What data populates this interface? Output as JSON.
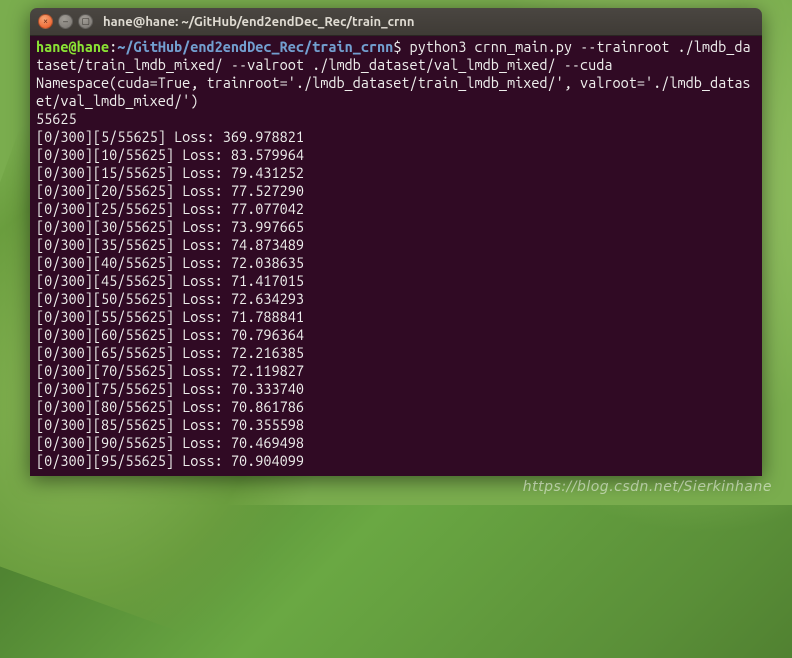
{
  "window": {
    "title": "hane@hane: ~/GitHub/end2endDec_Rec/train_crnn"
  },
  "prompt": {
    "user_host": "hane@hane",
    "colon": ":",
    "path": "~/GitHub/end2endDec_Rec/train_crnn",
    "dollar": "$"
  },
  "command": " python3 crnn_main.py --trainroot ./lmdb_dataset/train_lmdb_mixed/ --valroot ./lmdb_dataset/val_lmdb_mixed/ --cuda",
  "output_lines": [
    "Namespace(cuda=True, trainroot='./lmdb_dataset/train_lmdb_mixed/', valroot='./lmdb_dataset/val_lmdb_mixed/')",
    "55625",
    "[0/300][5/55625] Loss: 369.978821",
    "[0/300][10/55625] Loss: 83.579964",
    "[0/300][15/55625] Loss: 79.431252",
    "[0/300][20/55625] Loss: 77.527290",
    "[0/300][25/55625] Loss: 77.077042",
    "[0/300][30/55625] Loss: 73.997665",
    "[0/300][35/55625] Loss: 74.873489",
    "[0/300][40/55625] Loss: 72.038635",
    "[0/300][45/55625] Loss: 71.417015",
    "[0/300][50/55625] Loss: 72.634293",
    "[0/300][55/55625] Loss: 71.788841",
    "[0/300][60/55625] Loss: 70.796364",
    "[0/300][65/55625] Loss: 72.216385",
    "[0/300][70/55625] Loss: 72.119827",
    "[0/300][75/55625] Loss: 70.333740",
    "[0/300][80/55625] Loss: 70.861786",
    "[0/300][85/55625] Loss: 70.355598",
    "[0/300][90/55625] Loss: 70.469498",
    "[0/300][95/55625] Loss: 70.904099"
  ],
  "watermark": "https://blog.csdn.net/Sierkinhane"
}
